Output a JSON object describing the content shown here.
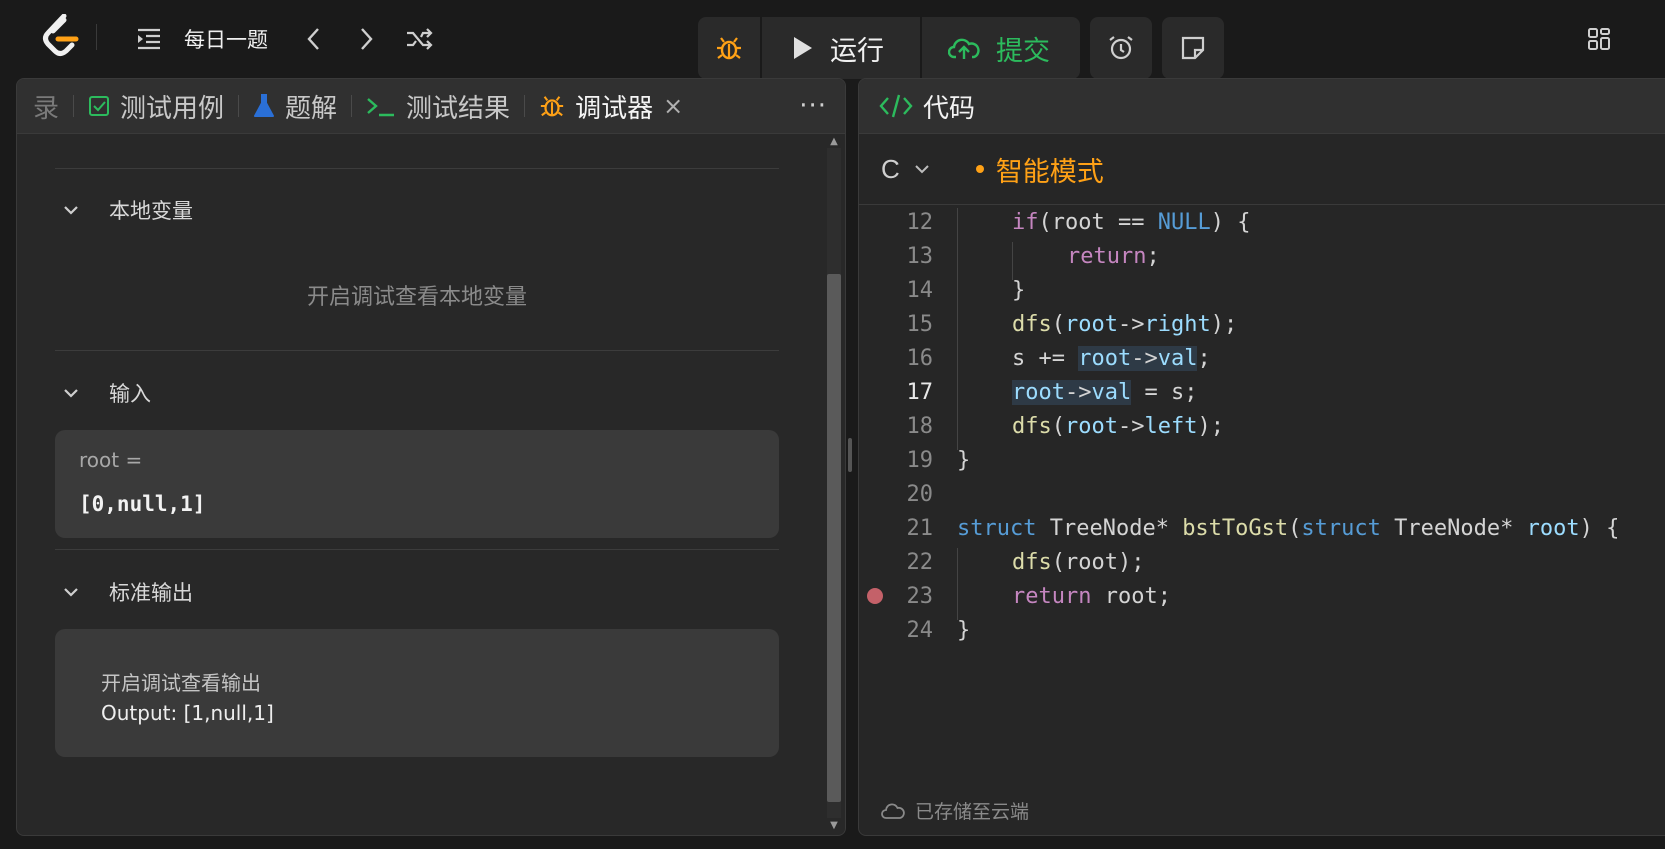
{
  "topbar": {
    "daily_label": "每日一题",
    "run_label": "运行",
    "submit_label": "提交"
  },
  "left_tabs": [
    {
      "label": "录"
    },
    {
      "label": "测试用例"
    },
    {
      "label": "题解"
    },
    {
      "label": "测试结果"
    },
    {
      "label": "调试器",
      "close": "×"
    }
  ],
  "more_label": "···",
  "debugger": {
    "locals": {
      "title": "本地变量",
      "placeholder": "开启调试查看本地变量"
    },
    "input": {
      "title": "输入",
      "var_name": "root =",
      "var_value": "[0,null,1]"
    },
    "stdout": {
      "title": "标准输出",
      "line1": "开启调试查看输出",
      "line2": "Output: [1,null,1]"
    }
  },
  "code_panel": {
    "title": "代码",
    "language": "C",
    "mode": "智能模式",
    "status": "已存储至云端",
    "current_line": 17,
    "breakpoint_line": 23,
    "lines": [
      {
        "n": "12",
        "text": "if(root == NULL) {"
      },
      {
        "n": "13",
        "text": "return;"
      },
      {
        "n": "14",
        "text": "}"
      },
      {
        "n": "15",
        "text": "dfs(root->right);"
      },
      {
        "n": "16",
        "text": "s += root->val;"
      },
      {
        "n": "17",
        "text": "root->val = s;"
      },
      {
        "n": "18",
        "text": "dfs(root->left);"
      },
      {
        "n": "19",
        "text": "}"
      },
      {
        "n": "20",
        "text": ""
      },
      {
        "n": "21",
        "text": "struct TreeNode* bstToGst(struct TreeNode* root) {"
      },
      {
        "n": "22",
        "text": "dfs(root);"
      },
      {
        "n": "23",
        "text": "return root;"
      },
      {
        "n": "24",
        "text": "}"
      }
    ]
  },
  "colors": {
    "accent": "#ffa116",
    "green": "#2cbb5d",
    "breakpoint": "#e06c75"
  }
}
